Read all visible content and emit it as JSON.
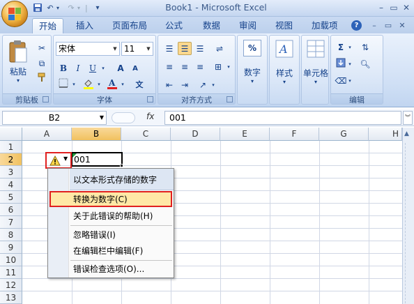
{
  "window": {
    "title": "Book1 - Microsoft Excel"
  },
  "tabs": [
    "开始",
    "插入",
    "页面布局",
    "公式",
    "数据",
    "审阅",
    "视图",
    "加载项"
  ],
  "ribbon": {
    "clipboard": {
      "paste_label": "粘贴",
      "group_label": "剪贴板"
    },
    "font": {
      "name": "宋体",
      "size": "11",
      "group_label": "字体",
      "bold": "B",
      "italic": "I",
      "underline": "U",
      "grow": "A",
      "shrink": "A",
      "wen": "文"
    },
    "alignment": {
      "group_label": "对齐方式"
    },
    "number": {
      "label": "数字",
      "percent": "%"
    },
    "styles": {
      "label": "样式"
    },
    "cells": {
      "label": "单元格"
    },
    "editing": {
      "group_label": "编辑",
      "sum": "Σ"
    }
  },
  "formula_bar": {
    "name_box": "B2",
    "fx": "fx",
    "content": "001"
  },
  "columns": [
    "A",
    "B",
    "C",
    "D",
    "E",
    "F",
    "G",
    "H"
  ],
  "rows": [
    "1",
    "2",
    "3",
    "4",
    "5",
    "6",
    "7",
    "8",
    "9",
    "10",
    "11",
    "12",
    "13"
  ],
  "cells": {
    "B2": "001"
  },
  "error_menu": {
    "title": "以文本形式存储的数字",
    "items": [
      "转换为数字(C)",
      "关于此错误的帮助(H)",
      "忽略错误(I)",
      "在编辑栏中编辑(F)",
      "错误检查选项(O)..."
    ]
  },
  "colors": {
    "highlight": "#ffe8a6",
    "callout": "#e02020",
    "accent": "#15428b"
  }
}
